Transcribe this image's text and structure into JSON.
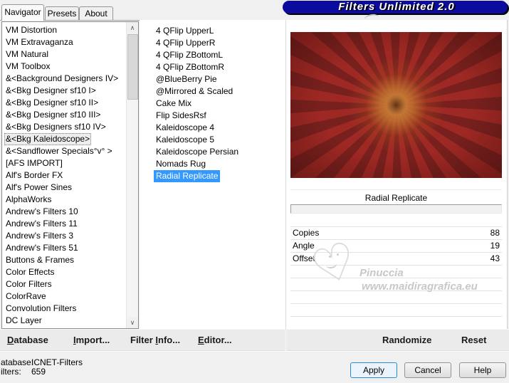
{
  "tabs": [
    {
      "label": "Navigator",
      "state": "active"
    },
    {
      "label": "Presets"
    },
    {
      "label": "About"
    }
  ],
  "logo": {
    "text": "Filters Unlimited 2.0",
    "bg_color": "#0b0b9e"
  },
  "icons": {
    "scroll_up": "∧",
    "scroll_down": "∨",
    "heart": "♡"
  },
  "category_list": {
    "items": [
      {
        "label": "VM Distortion"
      },
      {
        "label": "VM Extravaganza"
      },
      {
        "label": "VM Natural"
      },
      {
        "label": "VM Toolbox"
      },
      {
        "label": "&<Background Designers IV>"
      },
      {
        "label": "&<Bkg Designer sf10 I>"
      },
      {
        "label": "&<Bkg Designer sf10 II>"
      },
      {
        "label": "&<Bkg Designer sf10 III>"
      },
      {
        "label": "&<Bkg Designers sf10 IV>"
      },
      {
        "label": "&<Bkg Kaleidoscope>",
        "state": "focused"
      },
      {
        "label": "&<Sandflower Specials°v° >"
      },
      {
        "label": "[AFS IMPORT]"
      },
      {
        "label": "Alf's Border FX"
      },
      {
        "label": "Alf's Power Sines"
      },
      {
        "label": "AlphaWorks"
      },
      {
        "label": "Andrew's Filters 10"
      },
      {
        "label": "Andrew's Filters 11"
      },
      {
        "label": "Andrew's Filters 3"
      },
      {
        "label": "Andrew's Filters 51"
      },
      {
        "label": "Buttons & Frames"
      },
      {
        "label": "Color Effects"
      },
      {
        "label": "Color Filters"
      },
      {
        "label": "ColorRave"
      },
      {
        "label": "Convolution Filters"
      },
      {
        "label": "DC Layer"
      }
    ]
  },
  "filter_list": {
    "items": [
      {
        "label": "4 QFlip UpperL"
      },
      {
        "label": "4 QFlip UpperR"
      },
      {
        "label": "4 QFlip ZBottomL"
      },
      {
        "label": "4 QFlip ZBottomR"
      },
      {
        "label": "@BlueBerry Pie"
      },
      {
        "label": "@Mirrored & Scaled"
      },
      {
        "label": "Cake Mix"
      },
      {
        "label": "Flip SidesRsf"
      },
      {
        "label": "Kaleidoscope 4"
      },
      {
        "label": "Kaleidoscope 5"
      },
      {
        "label": "Kaleidoscope Persian"
      },
      {
        "label": "Nomads Rug"
      },
      {
        "label": "Radial Replicate",
        "state": "selected"
      }
    ],
    "selection_color": "#3399ff"
  },
  "preview": {
    "caption": "Radial Replicate",
    "colors": {
      "outer_red": "#9e2823",
      "ray_dark": "#77201d",
      "glow_orange": "#c8843a",
      "center_brown": "#5b2d14"
    }
  },
  "params": {
    "rows": [
      {
        "label": "Copies",
        "value": "88"
      },
      {
        "label": "Angle",
        "value": "19"
      },
      {
        "label": "Offset",
        "value": "43"
      },
      {
        "label": "",
        "value": ""
      },
      {
        "label": "",
        "value": ""
      },
      {
        "label": "",
        "value": ""
      },
      {
        "label": "",
        "value": ""
      }
    ]
  },
  "watermark": {
    "line1": "Pinuccia",
    "line2": "www.maidiragrafica.eu"
  },
  "toolbar": {
    "database": {
      "pre": "",
      "key": "D",
      "post": "atabase"
    },
    "import": {
      "pre": "",
      "key": "I",
      "post": "mport..."
    },
    "filter_info": {
      "pre": "Filter ",
      "key": "I",
      "post": "nfo..."
    },
    "editor": {
      "pre": "",
      "key": "E",
      "post": "ditor..."
    },
    "randomize": "Randomize",
    "reset": "Reset"
  },
  "statusbar": {
    "rows": [
      {
        "label": "atabase:",
        "value": "ICNET-Filters"
      },
      {
        "label": "ilters:",
        "value": "659"
      }
    ],
    "apply": "Apply",
    "cancel": "Cancel",
    "help": "Help"
  }
}
